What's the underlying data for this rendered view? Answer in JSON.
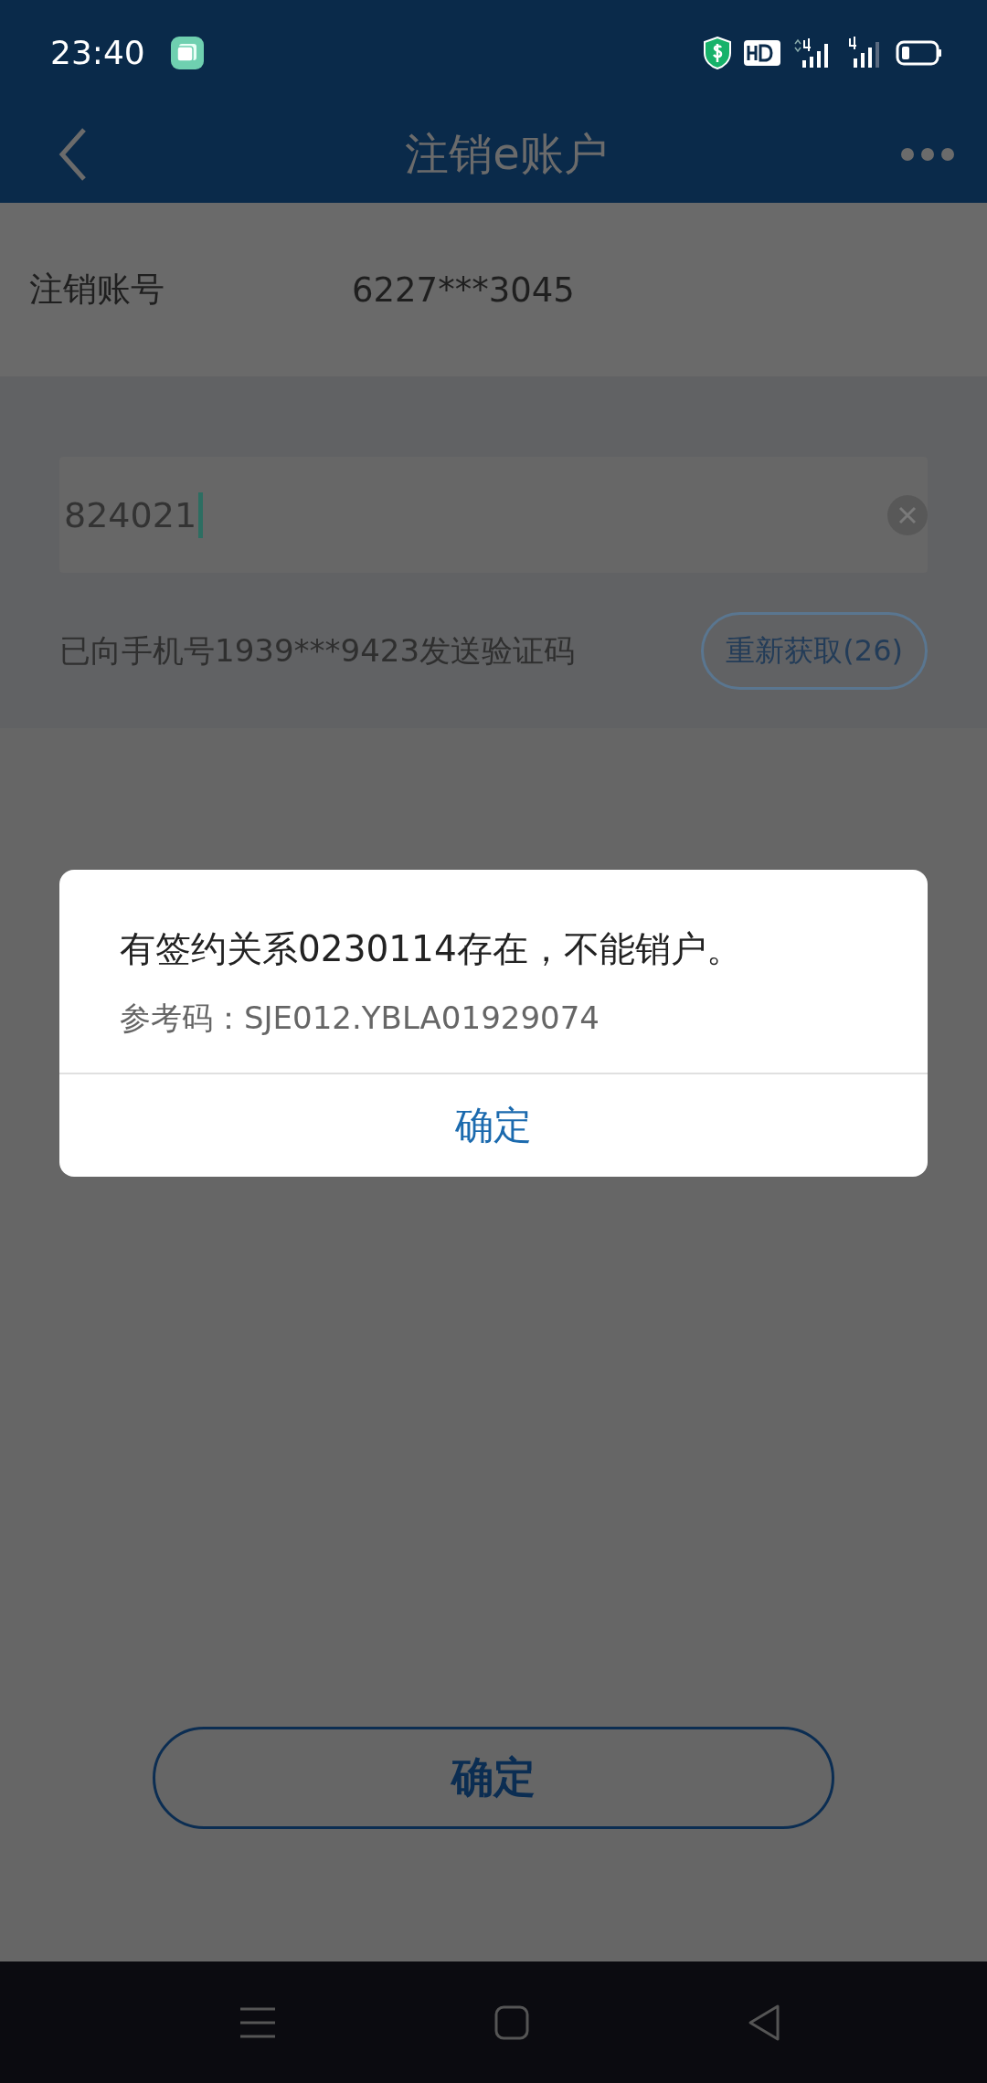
{
  "status_bar": {
    "time": "23:40"
  },
  "header": {
    "title": "注销e账户"
  },
  "account": {
    "label": "注销账号",
    "value": "6227***3045"
  },
  "code_field": {
    "value": "824021"
  },
  "sms": {
    "notice": "已向手机号1939***9423发送验证码",
    "resend_button": "重新获取(26)"
  },
  "dialog": {
    "message": "有签约关系0230114存在，不能销户。",
    "reference": "参考码：SJE012.YBLA01929074",
    "confirm": "确定"
  },
  "confirm_button": "确定"
}
